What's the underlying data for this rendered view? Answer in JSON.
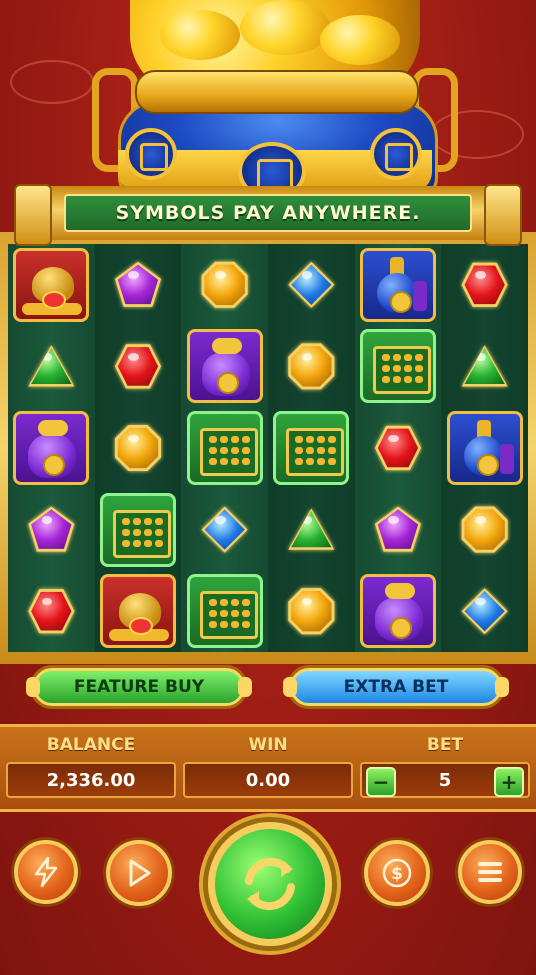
{
  "banner": {
    "text": "SYMBOLS PAY ANYWHERE."
  },
  "reels": {
    "rows": [
      [
        "frog",
        "purple-pentagon",
        "gold-octagon",
        "blue-diamond",
        "bottle",
        "red-hexagon"
      ],
      [
        "green-triangle",
        "red-hexagon",
        "bag",
        "gold-octagon",
        "ingots",
        "green-triangle"
      ],
      [
        "bag",
        "gold-octagon",
        "ingots",
        "ingots",
        "red-hexagon",
        "bottle"
      ],
      [
        "purple-pentagon",
        "ingots",
        "blue-diamond",
        "green-triangle",
        "purple-pentagon",
        "gold-octagon"
      ],
      [
        "red-hexagon",
        "frog",
        "ingots",
        "gold-octagon",
        "bag",
        "blue-diamond"
      ]
    ]
  },
  "buttons": {
    "feature_buy": "FEATURE BUY",
    "extra_bet": "EXTRA BET"
  },
  "info": {
    "balance_label": "BALANCE",
    "balance_value": "2,336.00",
    "win_label": "WIN",
    "win_value": "0.00",
    "bet_label": "BET",
    "bet_value": "5",
    "minus": "−",
    "plus": "+"
  },
  "controls": {
    "turbo_icon": "lightning-icon",
    "autoplay_icon": "play-icon",
    "spin_icon": "spin-arrows-icon",
    "coin_icon": "dollar-icon",
    "menu_icon": "hamburger-menu-icon"
  },
  "colors": {
    "green_button": "#2aa22c",
    "blue_button": "#1f86e6",
    "panel": "#c8731a",
    "background": "#a01e15"
  }
}
